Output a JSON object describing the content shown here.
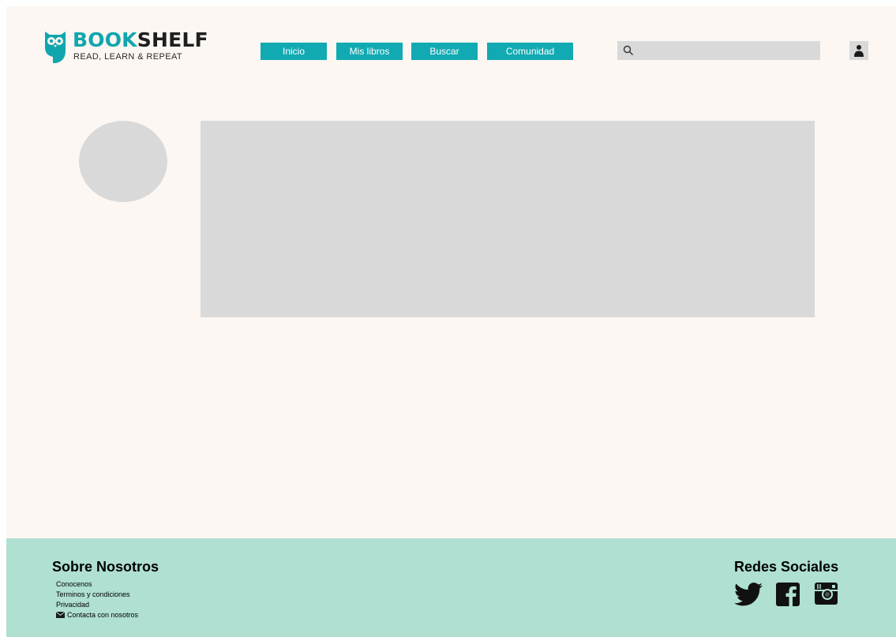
{
  "brand": {
    "name_accent": "BOOK",
    "name_rest": "SHELF",
    "tagline": "READ, LEARN & REPEAT",
    "accent_color": "#11a6ad",
    "icon": "owl-logo-icon"
  },
  "nav": {
    "items": [
      {
        "label": "Inicio"
      },
      {
        "label": "Mis libros"
      },
      {
        "label": "Buscar"
      },
      {
        "label": "Comunidad"
      }
    ]
  },
  "search": {
    "icon": "search-icon",
    "value": "",
    "placeholder": ""
  },
  "user": {
    "icon": "user-icon"
  },
  "footer": {
    "about": {
      "title": "Sobre Nosotros",
      "links": [
        {
          "label": "Conocenos"
        },
        {
          "label": "Terminos y condiciones"
        },
        {
          "label": "Privacidad"
        },
        {
          "label": "Contacta con nosotros",
          "icon": "mail-icon"
        }
      ]
    },
    "social": {
      "title": "Redes Sociales",
      "icons": [
        "twitter-icon",
        "facebook-icon",
        "instagram-icon"
      ]
    },
    "background": "#afe0d2"
  },
  "colors": {
    "page_bg": "#fcf7f2",
    "nav_bg": "#11aab2",
    "placeholder": "#d9d9d9"
  }
}
